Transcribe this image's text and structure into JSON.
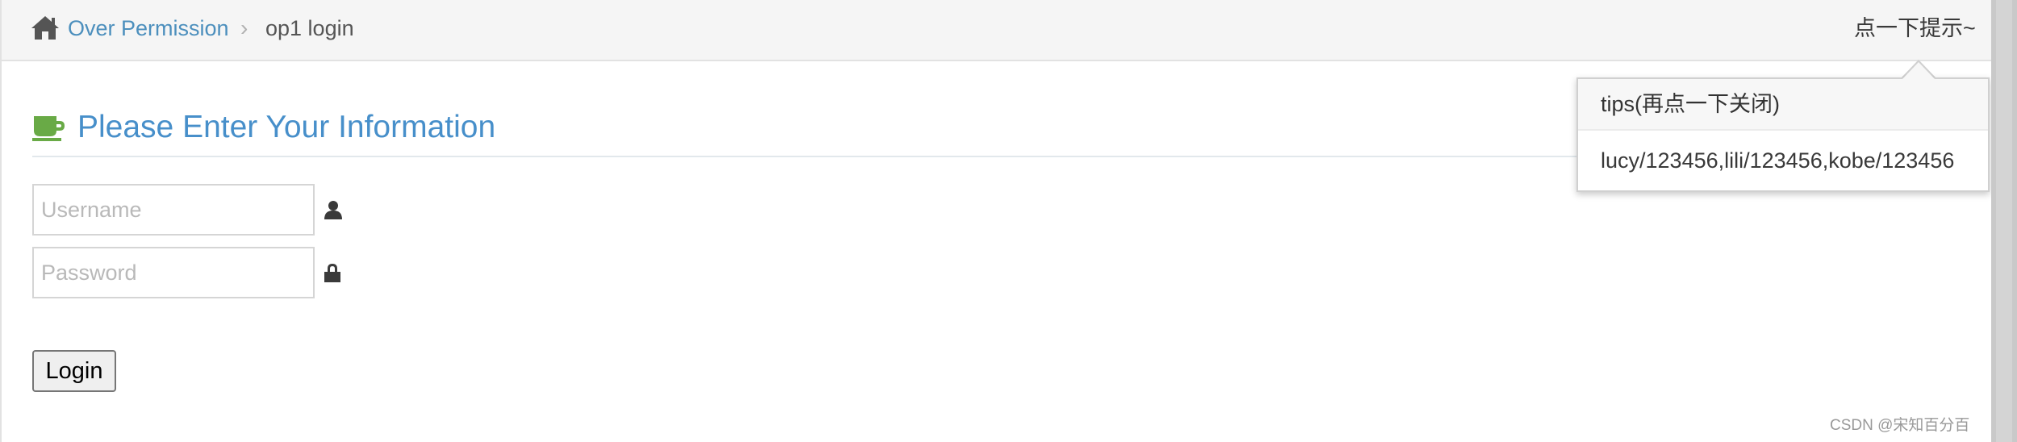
{
  "breadcrumb": {
    "home_icon": "home-icon",
    "section_link": "Over Permission",
    "separator": "›",
    "current": "op1 login"
  },
  "hint_toggle": {
    "label": "点一下提示~"
  },
  "popover": {
    "title": "tips(再点一下关闭)",
    "content": "lucy/123456,lili/123456,kobe/123456"
  },
  "header": {
    "icon": "coffee-cup-icon",
    "title": "Please Enter Your Information"
  },
  "form": {
    "username": {
      "value": "",
      "placeholder": "Username",
      "icon": "user-icon"
    },
    "password": {
      "value": "",
      "placeholder": "Password",
      "icon": "lock-icon"
    },
    "submit_label": "Login"
  },
  "watermark": "CSDN @宋知百分百",
  "colors": {
    "link": "#4c8fbd",
    "heading": "#478fca",
    "cup_icon": "#69aa46",
    "topbar_bg": "#f5f5f5"
  }
}
